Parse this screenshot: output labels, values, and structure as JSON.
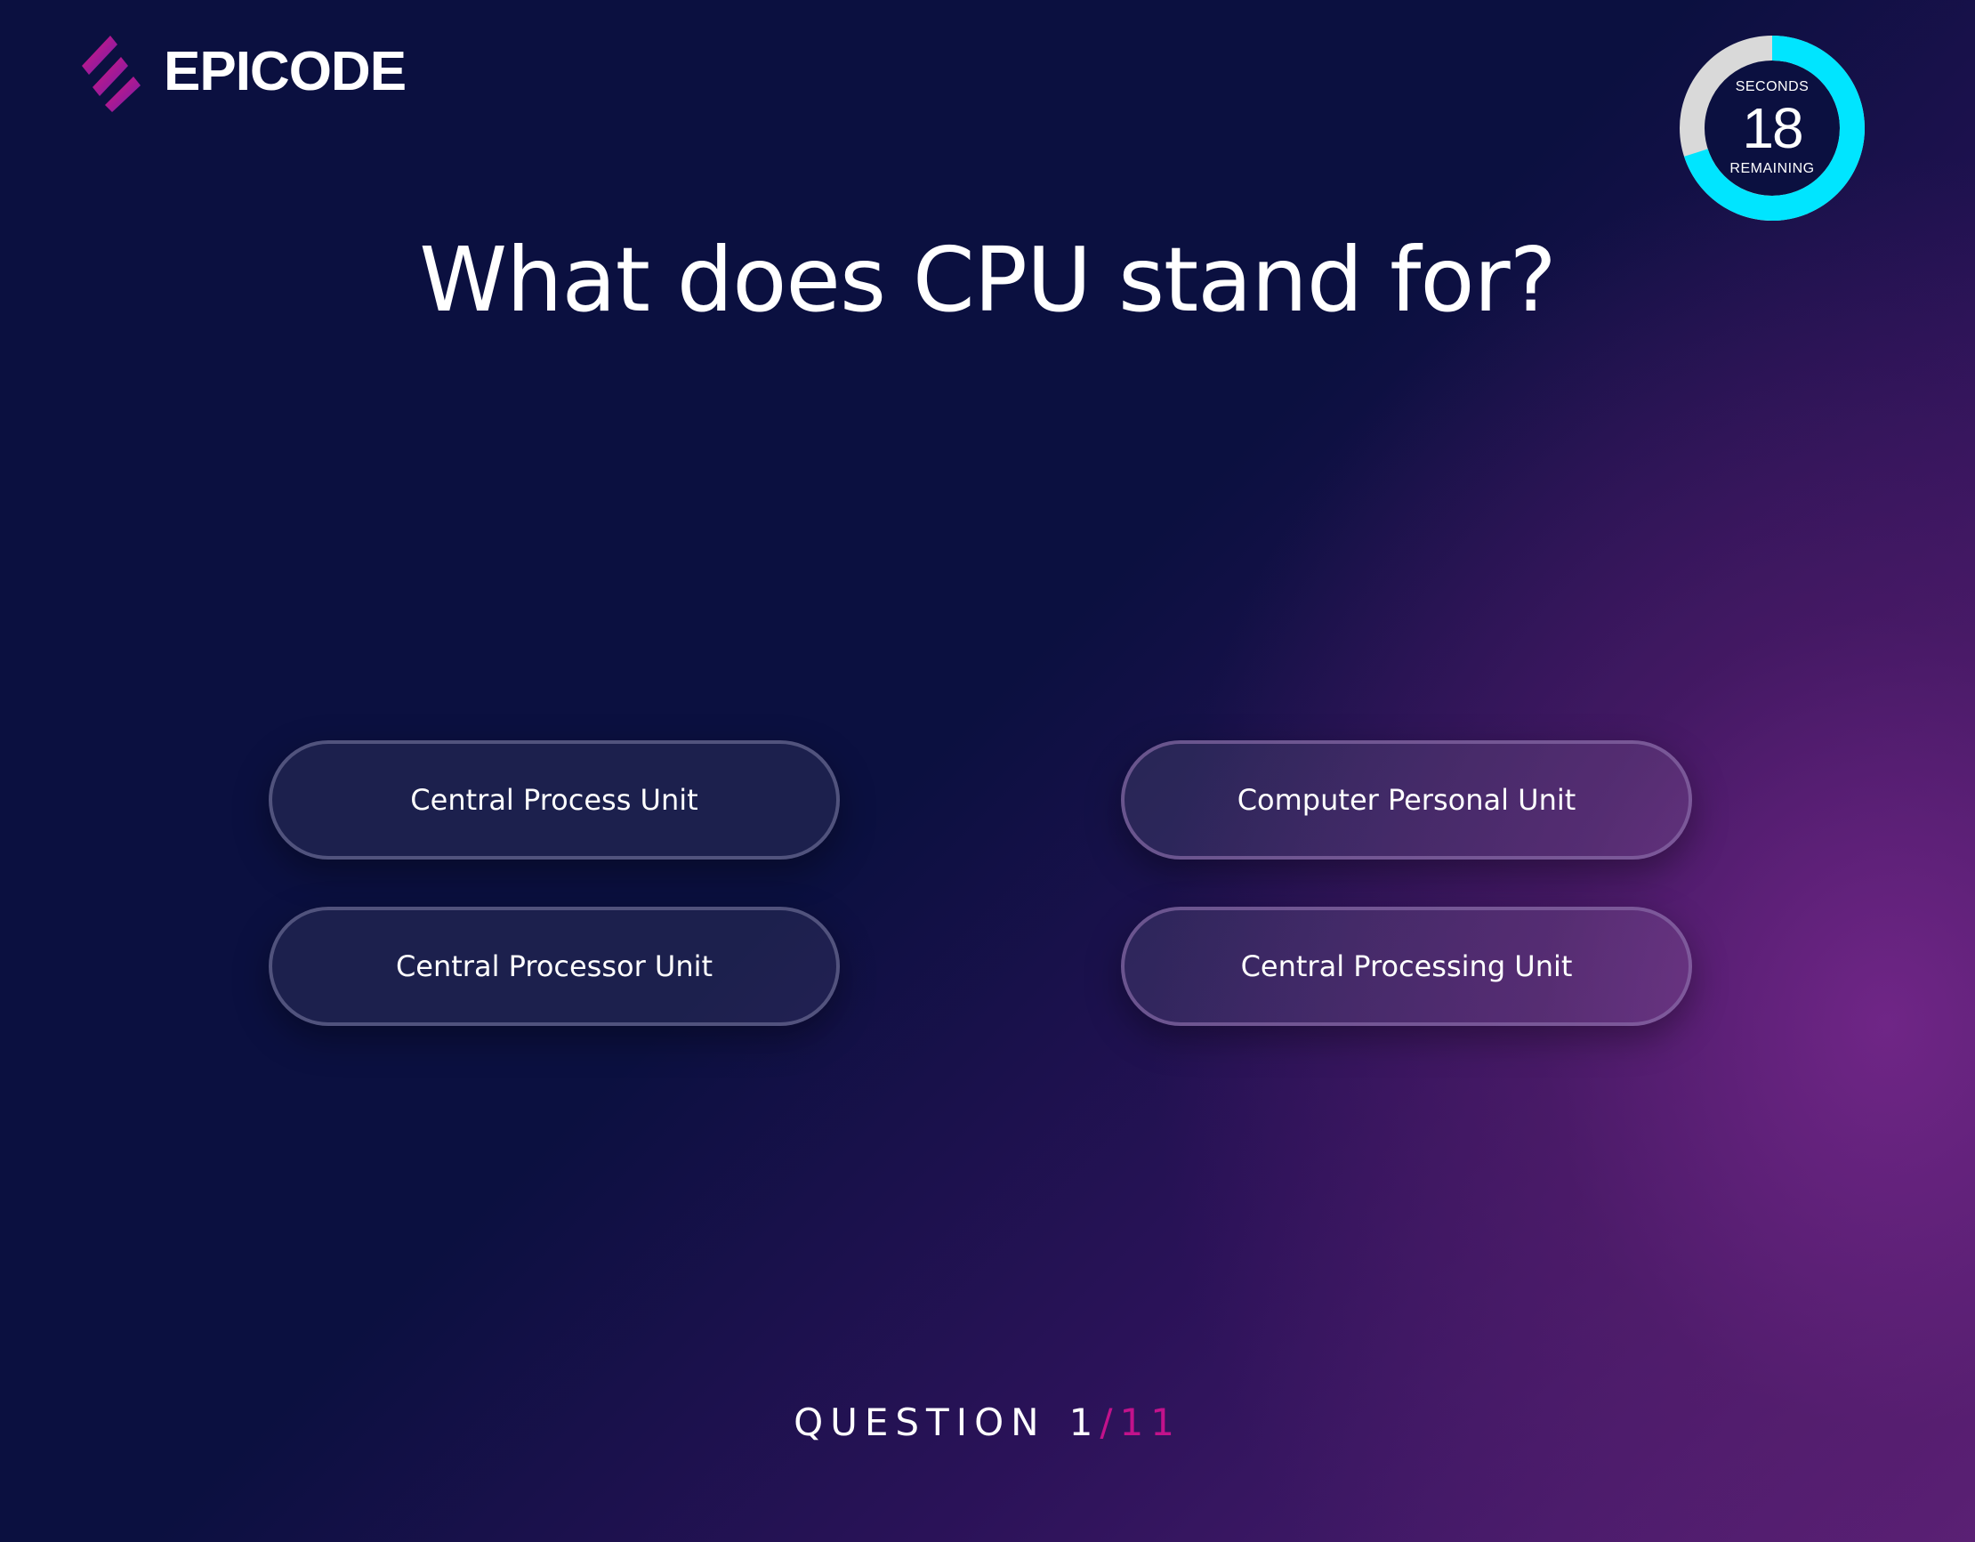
{
  "brand": {
    "name": "EPICODE",
    "logo_icon": "epicode-stripes-logo",
    "colors": {
      "logo_magenta": "#d4145a",
      "logo_purple": "#5b1fa8"
    }
  },
  "timer": {
    "top_label": "SECONDS",
    "value": "18",
    "bottom_label": "REMAINING",
    "ring_icon": "countdown-ring",
    "fraction_elapsed": 0.3,
    "colors": {
      "remaining": "#00e5ff",
      "elapsed": "#d9d9d9"
    }
  },
  "question": {
    "text": "What does CPU stand for?"
  },
  "answers": [
    {
      "label": "Central Process Unit"
    },
    {
      "label": "Computer Personal Unit"
    },
    {
      "label": "Central Processor Unit"
    },
    {
      "label": "Central Processing Unit"
    }
  ],
  "progress": {
    "prefix": "QUESTION",
    "current": "1",
    "separator": "/",
    "total": "11",
    "accent_color": "#c2128b"
  }
}
